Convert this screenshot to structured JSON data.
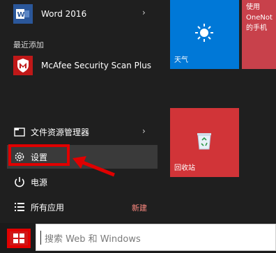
{
  "apps": {
    "word": {
      "label": "Word 2016"
    },
    "recently_added_header": "最近添加",
    "mcafee": {
      "label": "McAfee Security Scan Plus"
    }
  },
  "system": {
    "file_explorer": "文件资源管理器",
    "settings": "设置",
    "power": "电源",
    "all_apps": "所有应用",
    "new_badge": "新建"
  },
  "tiles": {
    "weather": {
      "label": "天气"
    },
    "onenote": {
      "lines": [
        "使用",
        "OneNot",
        "的手机"
      ]
    },
    "recycle_bin": {
      "label": "回收站"
    }
  },
  "search": {
    "placeholder": "搜索 Web 和 Windows"
  },
  "colors": {
    "accent_blue": "#0078d7",
    "recycle_red": "#d13438",
    "highlight_red": "#e00000"
  }
}
